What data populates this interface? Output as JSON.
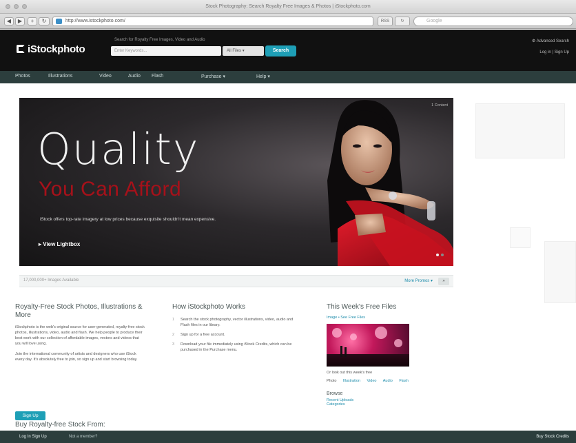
{
  "browser": {
    "window_title": "Stock Photography: Search Royalty Free Images & Photos | iStockphoto.com",
    "url": "http://www.istockphoto.com/",
    "google_placeholder": "Google"
  },
  "header": {
    "logo": "iStockphoto",
    "search_hint": "Search for Royalty Free Images, Video and Audio",
    "search_placeholder": "Enter Keywords...",
    "file_type": "All Files",
    "search_button": "Search",
    "account_top": "Advanced Search",
    "login": "Log in",
    "signup": "Sign Up"
  },
  "nav": {
    "items": [
      "Photos",
      "Illustrations",
      "Video",
      "Audio",
      "Flash",
      "Purchase",
      "Help"
    ]
  },
  "hero": {
    "title": "Quality",
    "tagline": "You Can Afford",
    "description": "iStock offers top-rate imagery at low prices because exquisite shouldn't mean expensive.",
    "link": "View Lightbox",
    "credit": "1 Content"
  },
  "infostrip": {
    "left": "17,000,000+ Images Available",
    "right": "More Promos",
    "pager": "»"
  },
  "col1": {
    "title": "Royalty-Free Stock Photos, Illustrations & More",
    "p1": "iStockphoto is the web's original source for user-generated, royalty-free stock photos, illustrations, video, audio and flash. We help people to produce their best work with our collection of affordable images, vectors and videos that you will love using.",
    "p2": "Join the international community of artists and designers who use iStock every day. It's absolutely free to join, so sign up and start browsing today.",
    "join_button": "Sign Up",
    "buy_heading": "Buy Royalty-free Stock From:"
  },
  "col2": {
    "title": "How iStockphoto Works",
    "steps": [
      "Search the stock photography, vector illustrations, video, audio and Flash files in our library.",
      "Sign up for a free account.",
      "Download your file immediately using iStock Credits, which can be purchased in the Purchase menu."
    ]
  },
  "col3": {
    "title": "This Week's Free Files",
    "subtitle": "Image • See Free Files",
    "caption": "Or look out this week's free",
    "tabs": [
      "Photo",
      "Illustration",
      "Video",
      "Audio",
      "Flash"
    ],
    "browse_title": "Browse",
    "browse_links": [
      "Recent Uploads",
      "Categories"
    ]
  },
  "footer": {
    "login": "Log In  Sign Up",
    "account": "Not a member?",
    "right": "Buy Stock Credits"
  }
}
